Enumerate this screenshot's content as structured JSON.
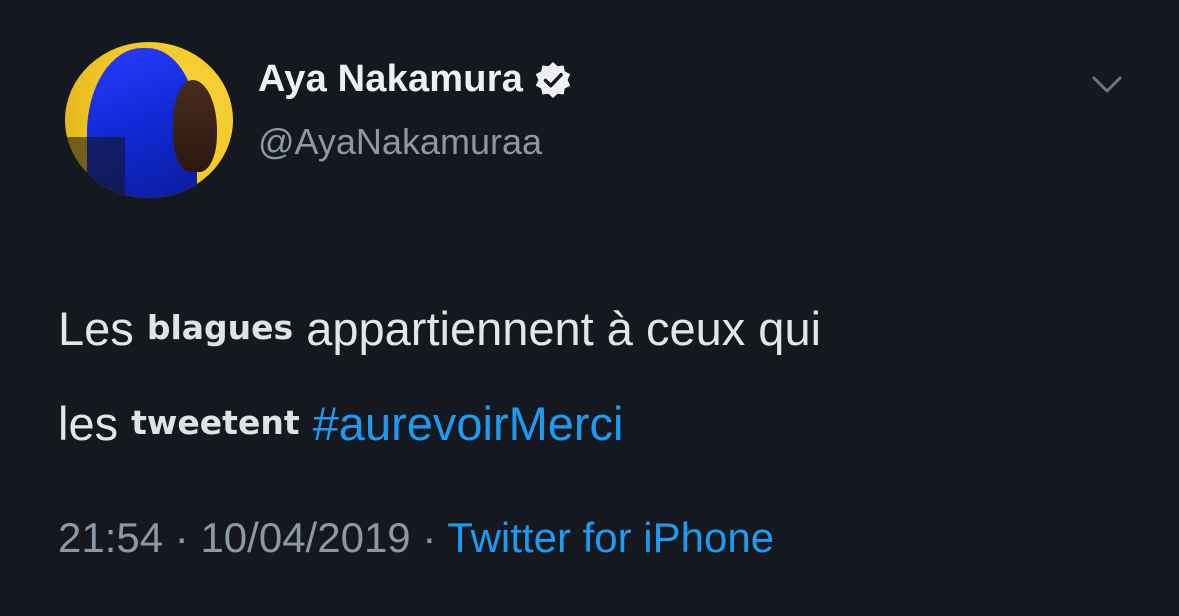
{
  "user": {
    "display_name": "Aya Nakamura",
    "handle": "@AyaNakamuraa",
    "verified": true
  },
  "tweet": {
    "line1": {
      "word1": "Les",
      "overlay_word": "blagues",
      "rest": "appartiennent à ceux qui"
    },
    "line2": {
      "word1": "les",
      "overlay_word": "tweetent",
      "hashtag": "#aurevoirMerci"
    }
  },
  "meta": {
    "time": "21:54",
    "separator": "·",
    "date": "10/04/2019",
    "source": "Twitter for iPhone"
  },
  "icons": {
    "verified": "verified-badge-icon",
    "more": "chevron-down-icon"
  },
  "colors": {
    "background": "#15181f",
    "link": "#1d9bf0",
    "secondary_text": "#8b98a5"
  }
}
